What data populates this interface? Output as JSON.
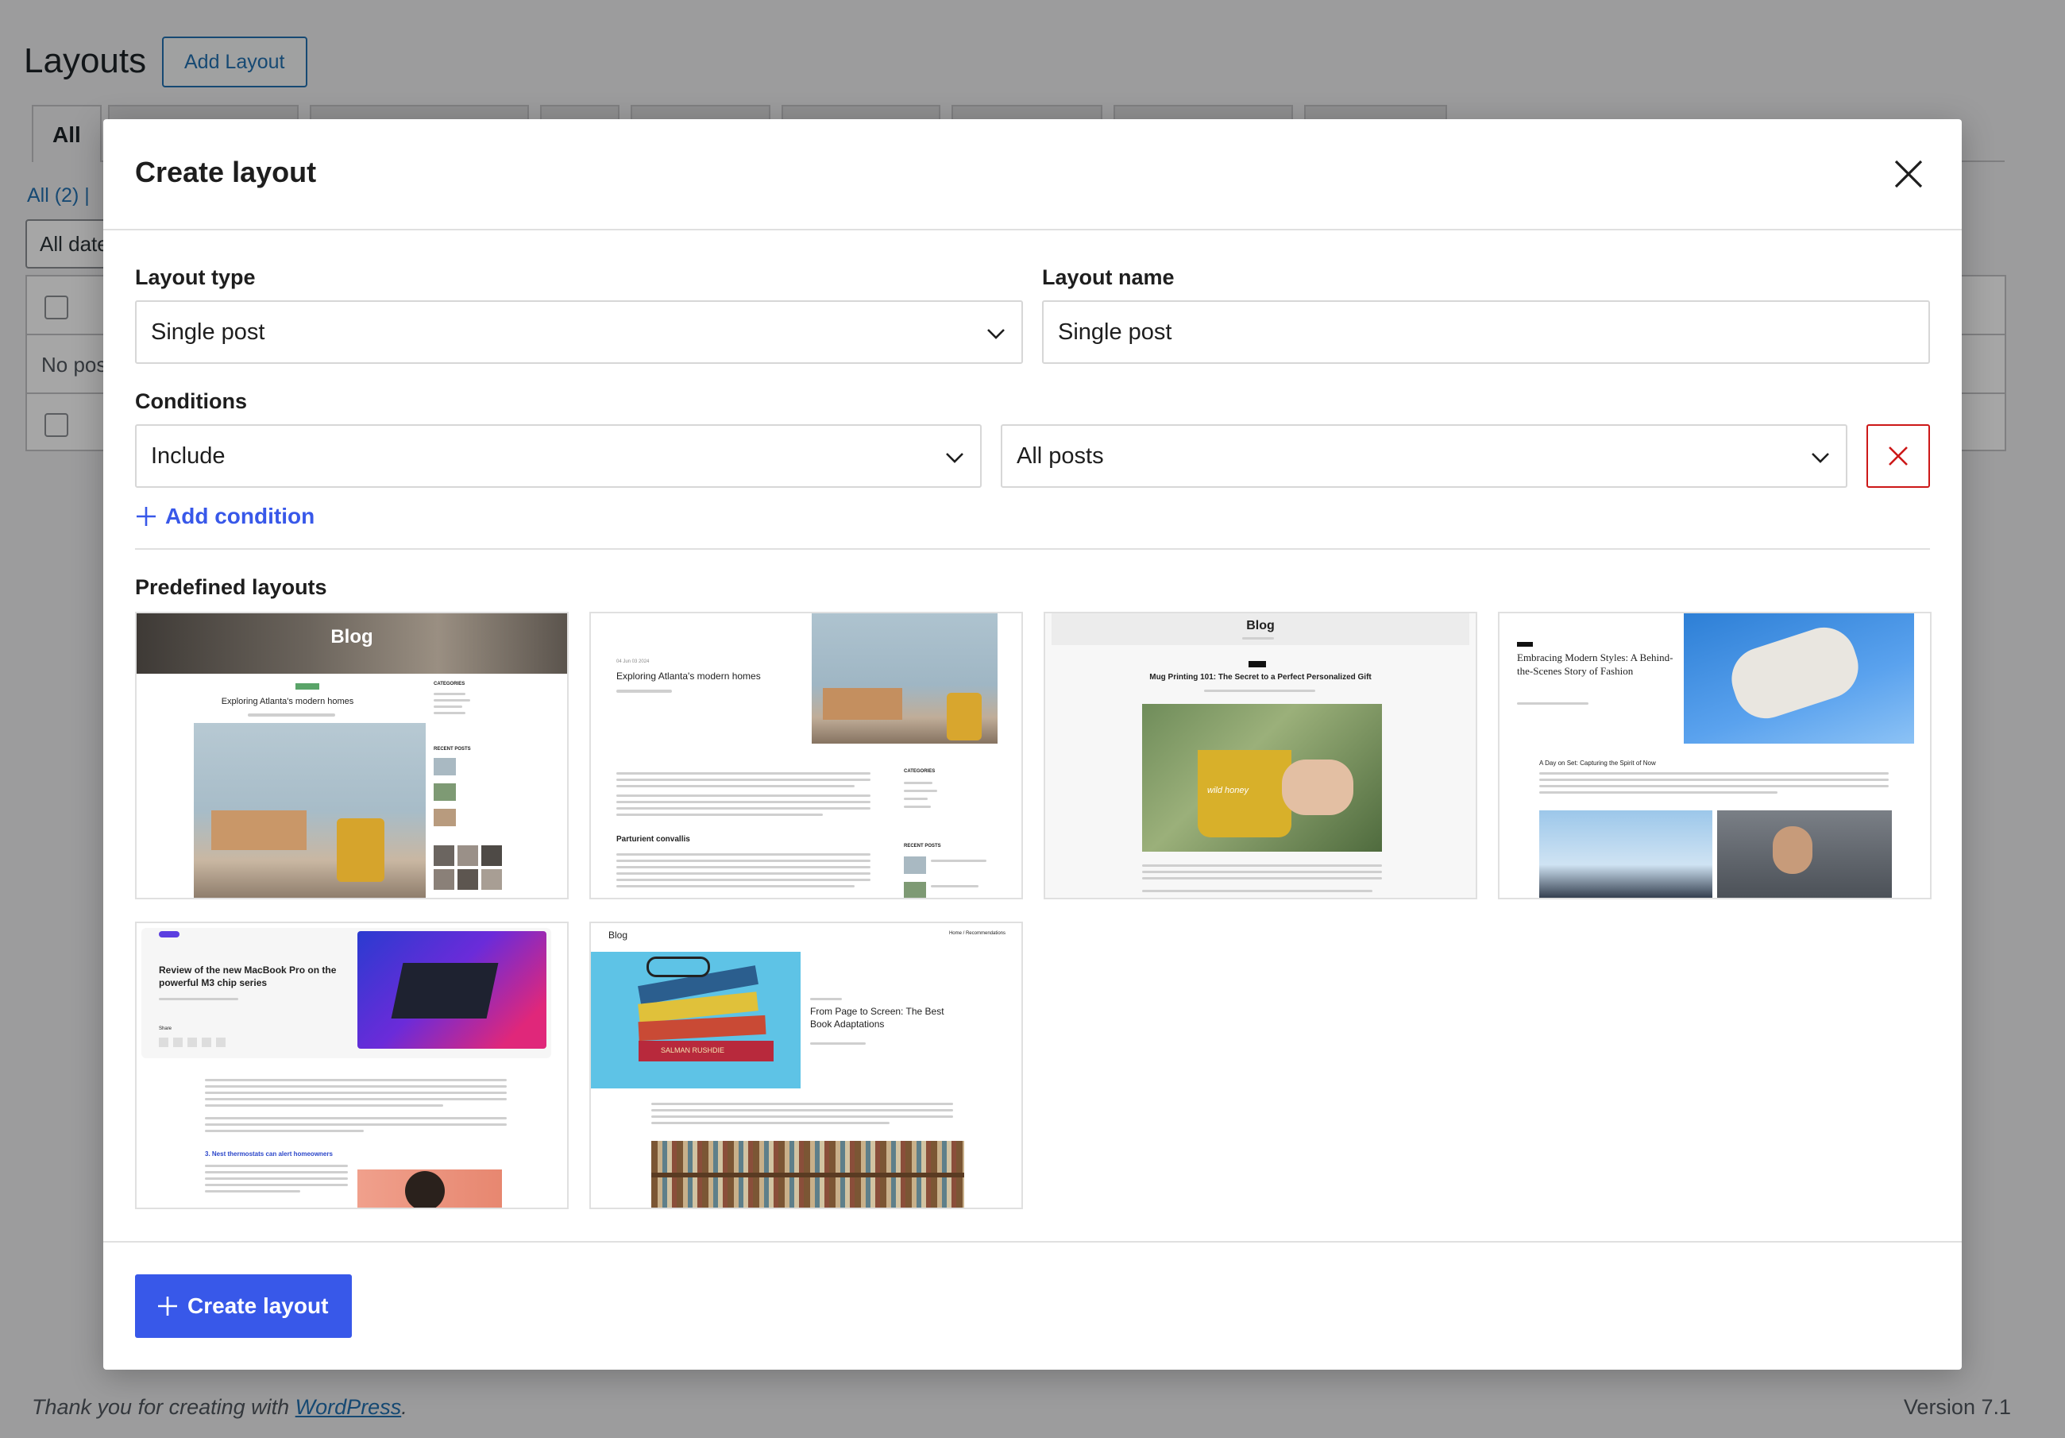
{
  "background": {
    "title": "Layouts",
    "add_button": "Add Layout",
    "active_tab": "All",
    "filter_all": "All (2) |",
    "date_filter": "All dates",
    "no_posts": "No pos",
    "footer_text": "Thank you for creating with ",
    "footer_link": "WordPress",
    "footer_period": ".",
    "version": "Version 7.1"
  },
  "modal": {
    "title": "Create layout",
    "layout_type_label": "Layout type",
    "layout_type_value": "Single post",
    "layout_name_label": "Layout name",
    "layout_name_value": "Single post",
    "conditions_label": "Conditions",
    "condition_mode": "Include",
    "condition_target": "All posts",
    "add_condition": "Add condition",
    "predefined_label": "Predefined layouts",
    "create_button": "Create layout"
  },
  "thumbnails": [
    {
      "heading": "Blog",
      "title": "Exploring Atlanta's modern homes",
      "sidebar": "CATEGORIES",
      "recent": "RECENT POSTS"
    },
    {
      "date": "04 Jun 03 2024",
      "title": "Exploring Atlanta's modern homes",
      "subhead": "Parturient convallis",
      "sidebar": "CATEGORIES",
      "recent": "RECENT POSTS"
    },
    {
      "heading": "Blog",
      "title": "Mug Printing 101: The Secret to a Perfect Personalized Gift",
      "mug_text": "wild honey"
    },
    {
      "title": "Embracing Modern Styles: A Behind-the-Scenes Story of Fashion",
      "subhead": "A Day on Set: Capturing the Spirit of Now"
    },
    {
      "title": "Review of the new MacBook Pro on the powerful M3 chip series",
      "share": "Share",
      "subhead": "3. Nest thermostats can alert homeowners"
    },
    {
      "heading": "Blog",
      "nav": "Home / Recommendations",
      "title": "From Page to Screen: The Best Book Adaptations",
      "book": "SALMAN RUSHDIE"
    }
  ],
  "colors": {
    "accent": "#3858e9",
    "danger": "#cc1818",
    "wp_link": "#2271b1"
  }
}
